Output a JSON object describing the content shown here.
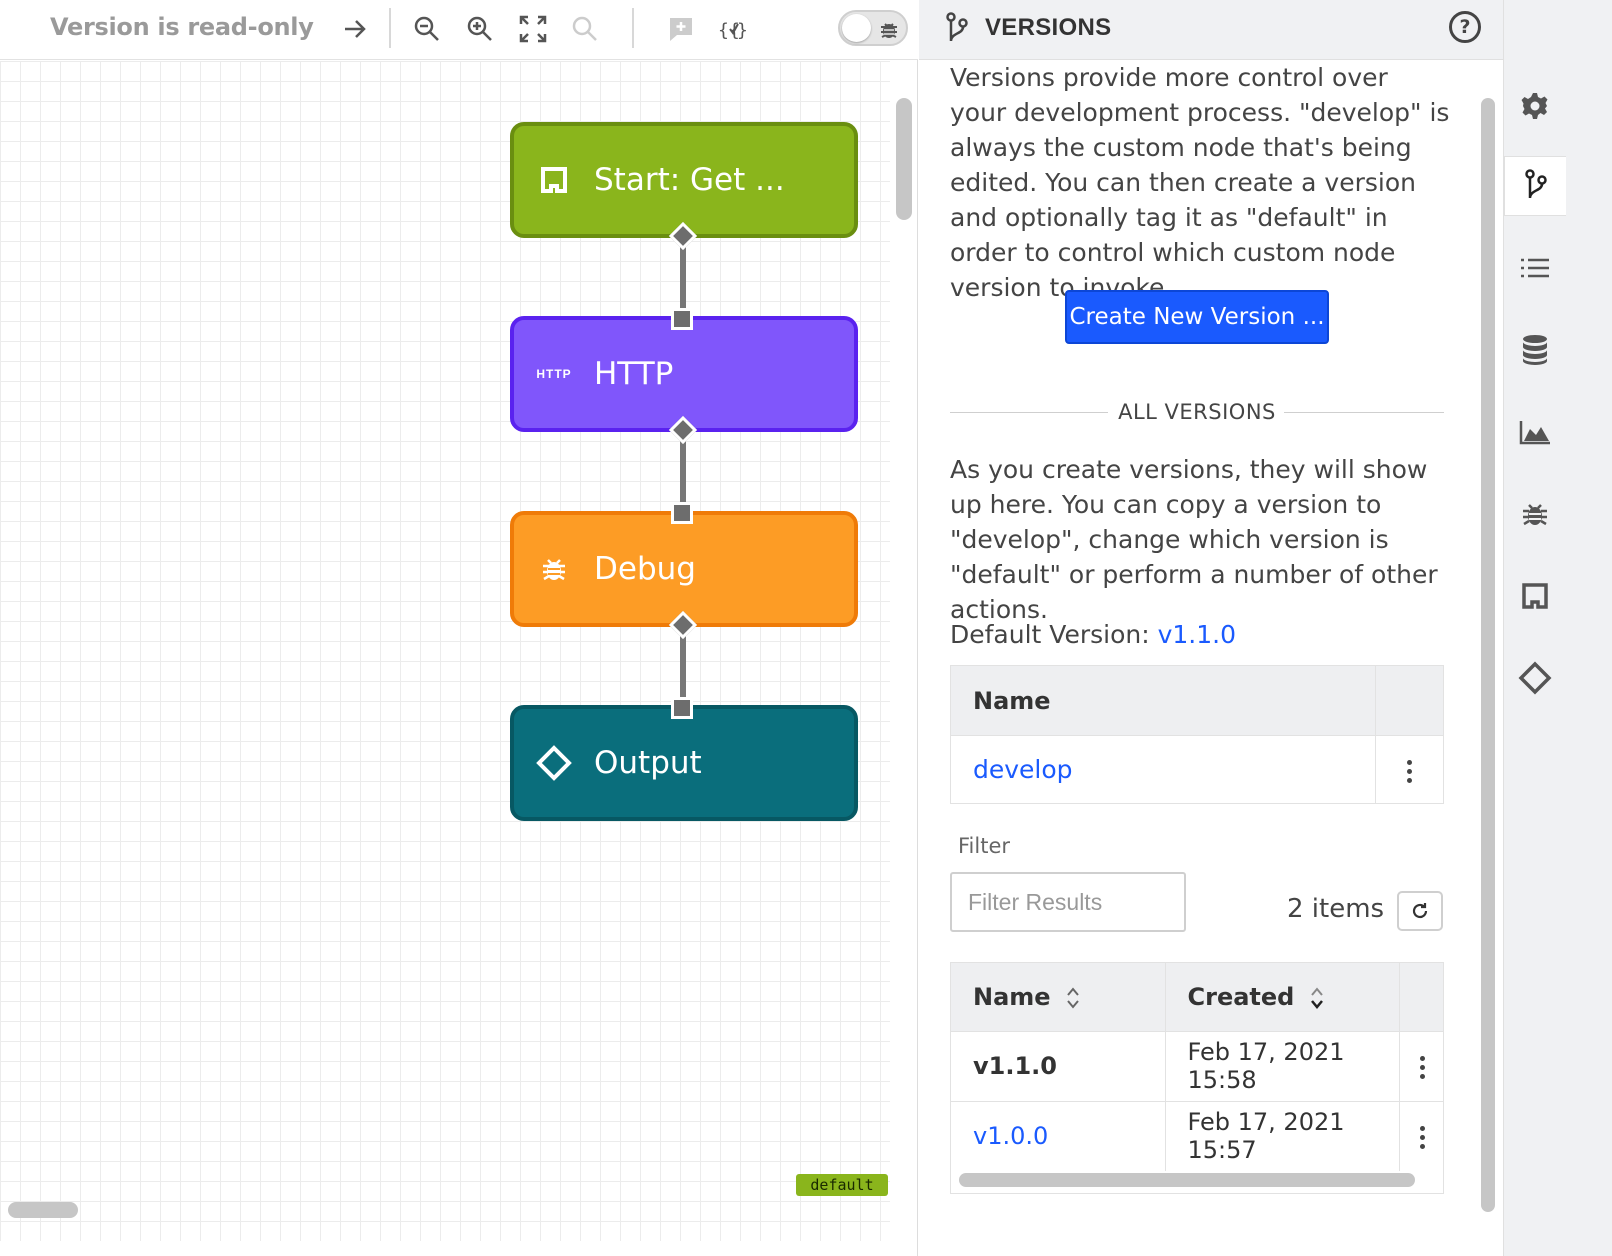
{
  "toolbar": {
    "read_only_label": "Version is read-only",
    "debug_toggle_on": false
  },
  "canvas": {
    "nodes": [
      {
        "label": "Start: Get ...",
        "icon": "square-outline-icon",
        "color": "#8ab51c"
      },
      {
        "label": "HTTP",
        "icon": "http-icon",
        "icon_text": "HTTP",
        "color": "#8056fb"
      },
      {
        "label": "Debug",
        "icon": "bug-icon",
        "color": "#fd9c25"
      },
      {
        "label": "Output",
        "icon": "diamond-outline-icon",
        "color": "#0a6e7c"
      }
    ],
    "default_tag": "default"
  },
  "versions_panel": {
    "title": "VERSIONS",
    "help_glyph": "?",
    "intro": "Versions provide more control over your development process. \"develop\" is always the custom node that's being edited. You can then create a version and optionally tag it as \"default\" in order to control which custom node version to invoke.",
    "create_button": "Create New Version ...",
    "all_versions_label": "ALL VERSIONS",
    "explain": "As you create versions, they will show up here. You can copy a version to \"develop\", change which version is \"default\" or perform a number of other actions.",
    "default_version_label": "Default Version:",
    "default_version_value": "v1.1.0",
    "develop_table": {
      "header": "Name",
      "row": "develop"
    },
    "filter": {
      "label": "Filter",
      "placeholder": "Filter Results",
      "value": ""
    },
    "item_count": "2 items",
    "versions_table": {
      "headers": [
        "Name",
        "Created"
      ],
      "rows": [
        {
          "name": "v1.1.0",
          "created": "Feb 17, 2021 15:58",
          "is_default": true
        },
        {
          "name": "v1.0.0",
          "created": "Feb 17, 2021 15:57",
          "is_default": false
        }
      ]
    }
  },
  "rail": {
    "items": [
      "gear-icon",
      "branch-icon",
      "list-icon",
      "database-icon",
      "area-chart-icon",
      "bug-icon",
      "square-outline-icon",
      "diamond-outline-icon"
    ],
    "active": "branch-icon"
  },
  "colors": {
    "accent": "#1a5afe",
    "start": "#8ab51c",
    "http": "#8056fb",
    "debug": "#fd9c25",
    "output": "#0a6e7c"
  }
}
